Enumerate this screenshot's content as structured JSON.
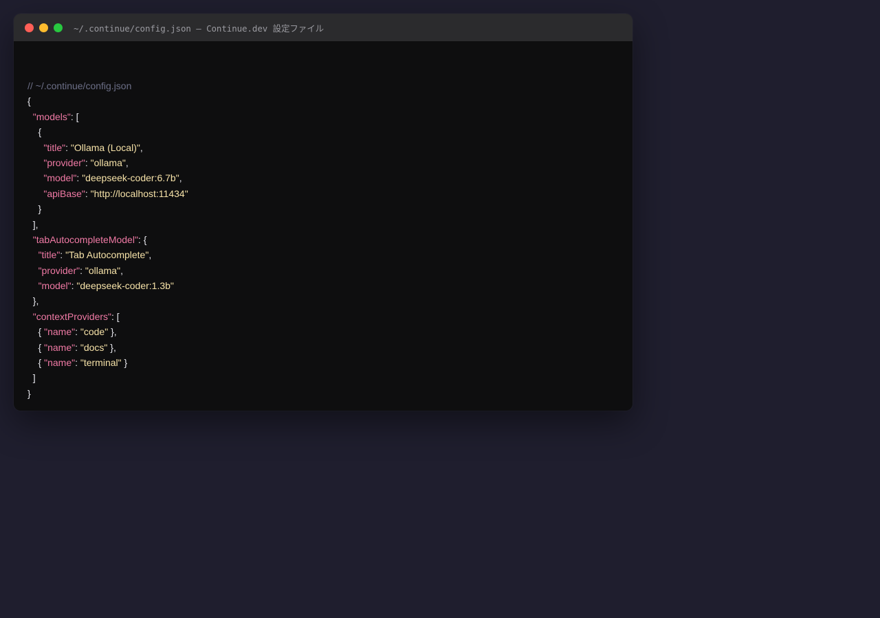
{
  "window": {
    "title": "~/.continue/config.json — Continue.dev 設定ファイル",
    "traffic_lights": {
      "close_color": "#ff5f57",
      "minimize_color": "#febc2e",
      "maximize_color": "#28c840"
    }
  },
  "colors": {
    "comment": "#6c6f87",
    "punctuation": "#e6e6ec",
    "key": "#f07aa5",
    "string": "#f6e2a8"
  },
  "code": {
    "lines": [
      [
        {
          "t": "comment",
          "v": "// ~/.continue/config.json"
        }
      ],
      [
        {
          "t": "punct",
          "v": "{"
        }
      ],
      [
        {
          "t": "punct",
          "v": "  "
        },
        {
          "t": "key",
          "v": "\"models\""
        },
        {
          "t": "punct",
          "v": ": ["
        }
      ],
      [
        {
          "t": "punct",
          "v": "    {"
        }
      ],
      [
        {
          "t": "punct",
          "v": "      "
        },
        {
          "t": "key",
          "v": "\"title\""
        },
        {
          "t": "punct",
          "v": ": "
        },
        {
          "t": "str",
          "v": "\"Ollama (Local)\""
        },
        {
          "t": "punct",
          "v": ","
        }
      ],
      [
        {
          "t": "punct",
          "v": "      "
        },
        {
          "t": "key",
          "v": "\"provider\""
        },
        {
          "t": "punct",
          "v": ": "
        },
        {
          "t": "str",
          "v": "\"ollama\""
        },
        {
          "t": "punct",
          "v": ","
        }
      ],
      [
        {
          "t": "punct",
          "v": "      "
        },
        {
          "t": "key",
          "v": "\"model\""
        },
        {
          "t": "punct",
          "v": ": "
        },
        {
          "t": "str",
          "v": "\"deepseek-coder:6.7b\""
        },
        {
          "t": "punct",
          "v": ","
        }
      ],
      [
        {
          "t": "punct",
          "v": "      "
        },
        {
          "t": "key",
          "v": "\"apiBase\""
        },
        {
          "t": "punct",
          "v": ": "
        },
        {
          "t": "str",
          "v": "\"http://localhost:11434\""
        }
      ],
      [
        {
          "t": "punct",
          "v": "    }"
        }
      ],
      [
        {
          "t": "punct",
          "v": "  ],"
        }
      ],
      [
        {
          "t": "punct",
          "v": "  "
        },
        {
          "t": "key",
          "v": "\"tabAutocompleteModel\""
        },
        {
          "t": "punct",
          "v": ": {"
        }
      ],
      [
        {
          "t": "punct",
          "v": "    "
        },
        {
          "t": "key",
          "v": "\"title\""
        },
        {
          "t": "punct",
          "v": ": "
        },
        {
          "t": "str",
          "v": "\"Tab Autocomplete\""
        },
        {
          "t": "punct",
          "v": ","
        }
      ],
      [
        {
          "t": "punct",
          "v": "    "
        },
        {
          "t": "key",
          "v": "\"provider\""
        },
        {
          "t": "punct",
          "v": ": "
        },
        {
          "t": "str",
          "v": "\"ollama\""
        },
        {
          "t": "punct",
          "v": ","
        }
      ],
      [
        {
          "t": "punct",
          "v": "    "
        },
        {
          "t": "key",
          "v": "\"model\""
        },
        {
          "t": "punct",
          "v": ": "
        },
        {
          "t": "str",
          "v": "\"deepseek-coder:1.3b\""
        }
      ],
      [
        {
          "t": "punct",
          "v": "  },"
        }
      ],
      [
        {
          "t": "punct",
          "v": "  "
        },
        {
          "t": "key",
          "v": "\"contextProviders\""
        },
        {
          "t": "punct",
          "v": ": ["
        }
      ],
      [
        {
          "t": "punct",
          "v": "    { "
        },
        {
          "t": "key",
          "v": "\"name\""
        },
        {
          "t": "punct",
          "v": ": "
        },
        {
          "t": "str",
          "v": "\"code\""
        },
        {
          "t": "punct",
          "v": " },"
        }
      ],
      [
        {
          "t": "punct",
          "v": "    { "
        },
        {
          "t": "key",
          "v": "\"name\""
        },
        {
          "t": "punct",
          "v": ": "
        },
        {
          "t": "str",
          "v": "\"docs\""
        },
        {
          "t": "punct",
          "v": " },"
        }
      ],
      [
        {
          "t": "punct",
          "v": "    { "
        },
        {
          "t": "key",
          "v": "\"name\""
        },
        {
          "t": "punct",
          "v": ": "
        },
        {
          "t": "str",
          "v": "\"terminal\""
        },
        {
          "t": "punct",
          "v": " }"
        }
      ],
      [
        {
          "t": "punct",
          "v": "  ]"
        }
      ],
      [
        {
          "t": "punct",
          "v": "}"
        }
      ]
    ]
  }
}
